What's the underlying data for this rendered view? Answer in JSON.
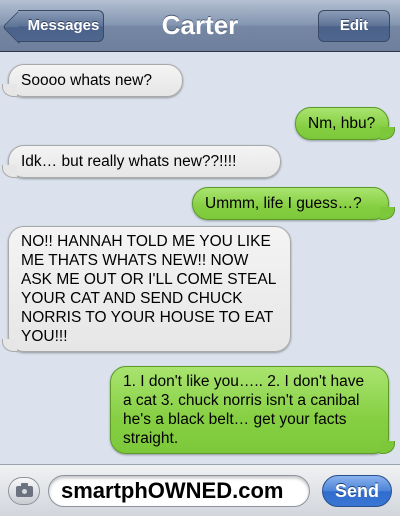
{
  "nav": {
    "title": "Carter",
    "back_label": "Messages",
    "edit_label": "Edit"
  },
  "messages": [
    {
      "sender": "them",
      "text": "Soooo whats new?"
    },
    {
      "sender": "me",
      "text": "Nm, hbu?"
    },
    {
      "sender": "them",
      "text": "Idk… but really whats new??!!!!"
    },
    {
      "sender": "me",
      "text": "Ummm, life I guess…?"
    },
    {
      "sender": "them",
      "text": "NO!! HANNAH TOLD ME YOU LIKE ME THATS WHATS NEW!! NOW ASK ME OUT OR I'LL COME STEAL YOUR CAT AND SEND CHUCK NORRIS TO YOUR HOUSE TO EAT YOU!!!"
    },
    {
      "sender": "me",
      "text": "1. I don't like you….. 2. I don't have a cat 3. chuck norris isn't a canibal he's a black belt… get your facts straight."
    }
  ],
  "input": {
    "value": "smartphOWNED.com",
    "send_label": "Send",
    "camera_icon": "camera-icon"
  },
  "colors": {
    "sent_bubble": "#86cf43",
    "received_bubble": "#e6e6e6",
    "background": "#dbe2ed",
    "send_button": "#3a76d3"
  }
}
